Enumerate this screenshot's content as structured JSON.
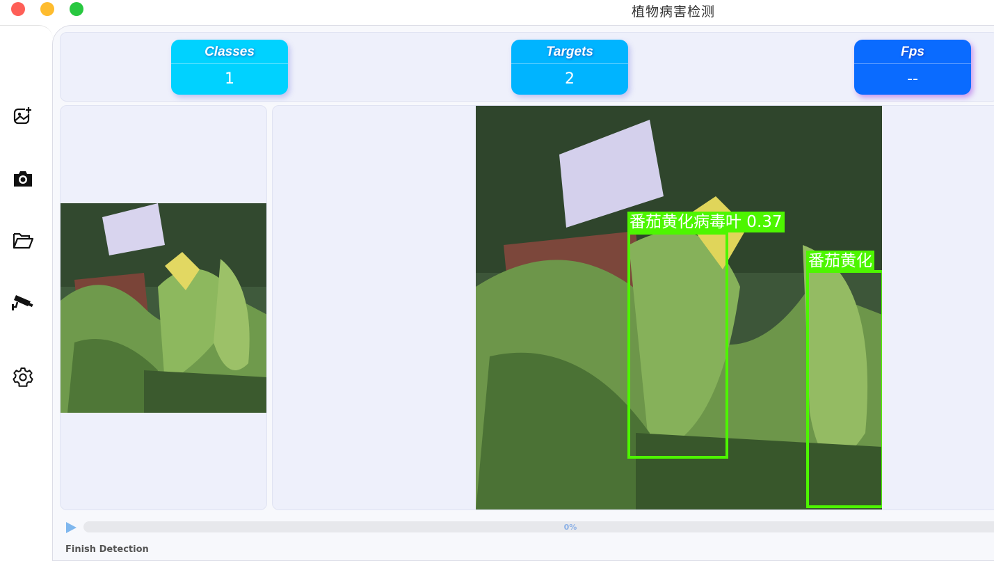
{
  "window": {
    "title": "植物病害检测"
  },
  "sidebar": {
    "items": [
      {
        "icon": "add-image-icon"
      },
      {
        "icon": "camera-icon"
      },
      {
        "icon": "folder-open-icon"
      },
      {
        "icon": "cctv-camera-icon"
      },
      {
        "icon": "gear-icon"
      }
    ]
  },
  "stats": {
    "classes": {
      "label": "Classes",
      "value": "1"
    },
    "targets": {
      "label": "Targets",
      "value": "2"
    },
    "fps": {
      "label": "Fps",
      "value": "--"
    }
  },
  "detections": [
    {
      "label": "番茄黄化病毒叶 0.37"
    },
    {
      "label": "番茄黄化"
    }
  ],
  "progress": {
    "value": 0,
    "text": "0%"
  },
  "status": {
    "text": "Finish Detection"
  },
  "colors": {
    "bbox": "#4df600",
    "classes_card": "#00d2ff",
    "targets_card": "#00b4ff",
    "fps_card": "#0a6bff"
  }
}
